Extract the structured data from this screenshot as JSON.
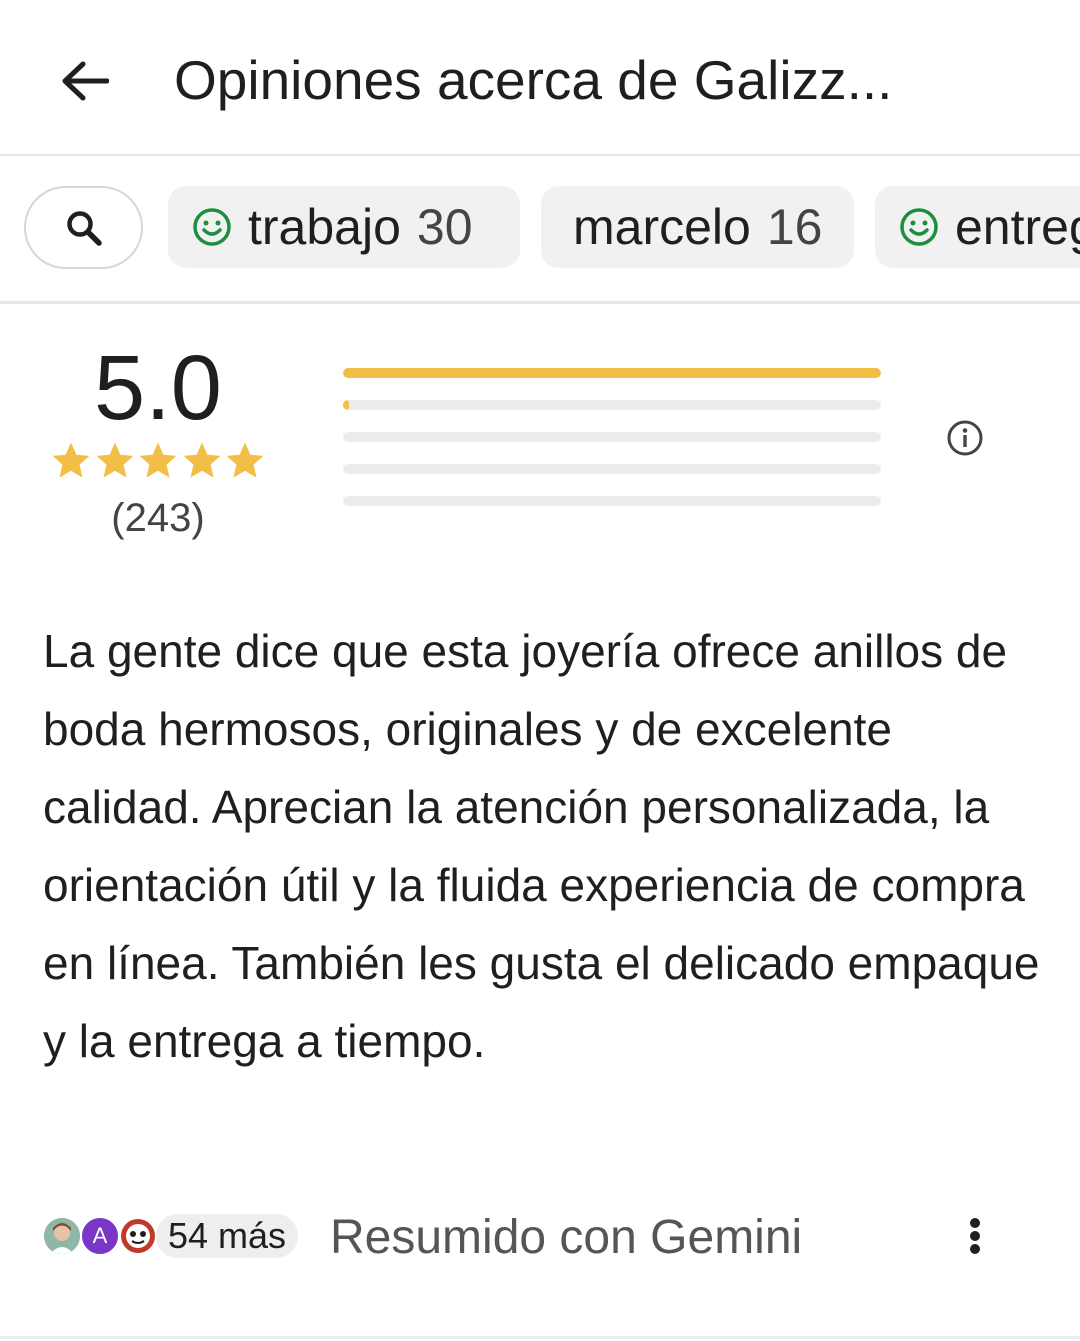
{
  "header": {
    "title": "Opiniones acerca de Galizz...",
    "back_icon": "arrow-left-icon"
  },
  "chips": [
    {
      "label": "trabajo",
      "count": "30",
      "icon": "smile-icon"
    },
    {
      "label": "marcelo",
      "count": "16",
      "icon": ""
    },
    {
      "label": "entreg",
      "count": "",
      "icon": "smile-icon"
    }
  ],
  "rating": {
    "score": "5.0",
    "stars": 5,
    "count": "(243)",
    "distribution": [
      1.0,
      0.01,
      0.0,
      0.0,
      0.0
    ]
  },
  "summary": {
    "text": "La gente dice que esta joyería ofrece anillos de boda hermosos, originales y de excelente calidad. Aprecian la atención personalizada, la orientación útil y la fluida experiencia de compra en línea. También les gusta el delicado empaque y la entrega a tiempo."
  },
  "footer": {
    "avatar_letter": "A",
    "more_label": "54 más",
    "gemini_label": "Resumido con Gemini"
  },
  "colors": {
    "accent_star": "#f3be45",
    "smile_green": "#1e8e3e"
  }
}
